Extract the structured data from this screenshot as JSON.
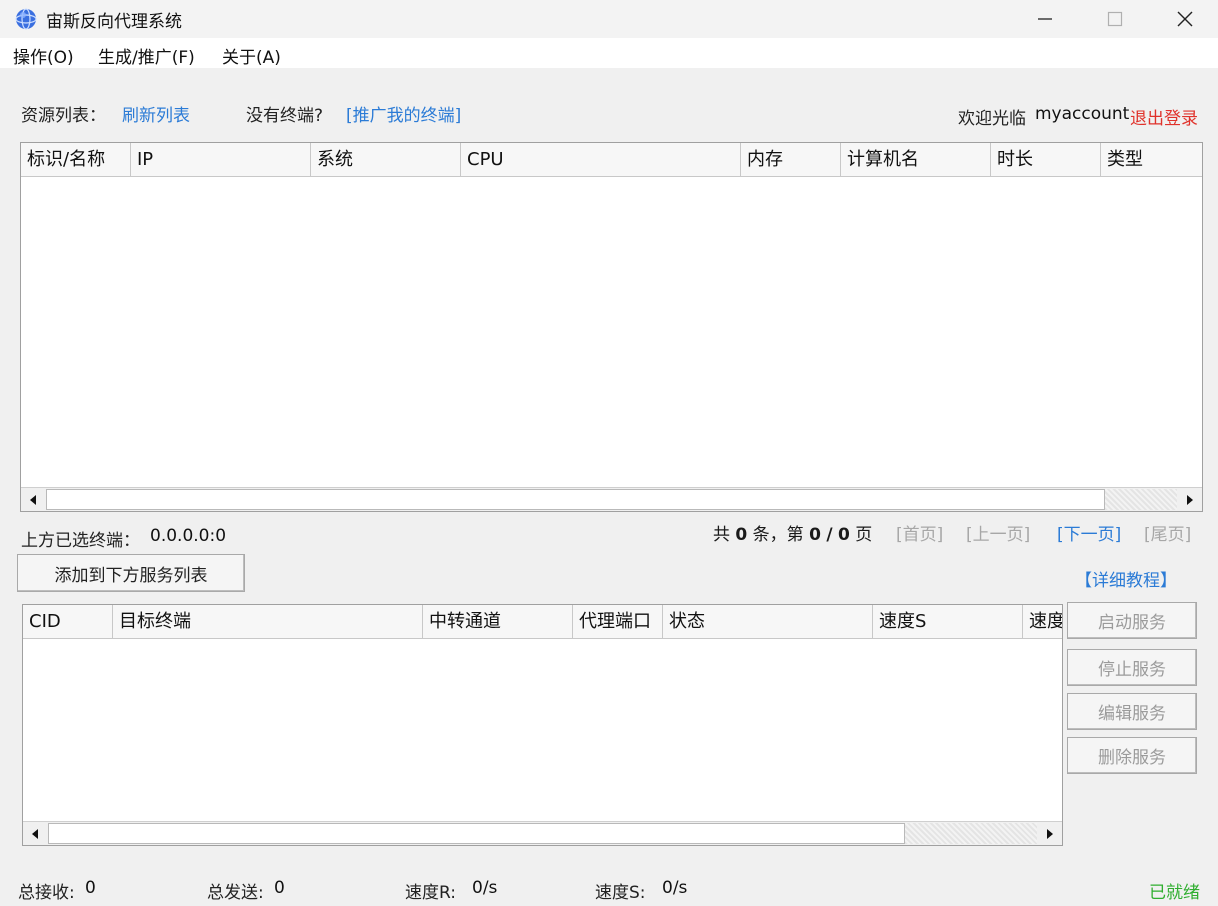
{
  "window": {
    "title": "宙斯反向代理系统",
    "controls": {
      "minimize": "—",
      "maximize": "☐",
      "close": "✕"
    }
  },
  "menu": [
    {
      "label": "操作(O)"
    },
    {
      "label": "生成/推广(F)"
    },
    {
      "label": "关于(A)"
    }
  ],
  "top_bar": {
    "resource_label": "资源列表：",
    "refresh_link": "刷新列表",
    "no_terminal_label": "没有终端?",
    "promote_link": "[推广我的终端]",
    "welcome_label": "欢迎光临",
    "username": "myaccount",
    "logout_link": "退出登录"
  },
  "terminal_table": {
    "columns": [
      "标识/名称",
      "IP",
      "系统",
      "CPU",
      "内存",
      "计算机名",
      "时长",
      "类型"
    ],
    "rows": []
  },
  "selection": {
    "label": "上方已选终端：",
    "value": "0.0.0.0:0"
  },
  "pagination": {
    "total_prefix": "共",
    "total_count": "0",
    "total_suffix": "条，第",
    "current_page": "0",
    "separator": "/",
    "total_pages": "0",
    "page_suffix": "页",
    "first": "[首页]",
    "prev": "[上一页]",
    "next": "[下一页]",
    "last": "[尾页]"
  },
  "add_button": "添加到下方服务列表",
  "tutorial_link": "【详细教程】",
  "service_table": {
    "columns": [
      "CID",
      "目标终端",
      "中转通道",
      "代理端口",
      "状态",
      "速度S",
      "速度"
    ],
    "rows": []
  },
  "service_buttons": {
    "start": "启动服务",
    "stop": "停止服务",
    "edit": "编辑服务",
    "delete": "删除服务"
  },
  "status_bar": {
    "recv_label": "总接收:",
    "recv_value": "0",
    "send_label": "总发送:",
    "send_value": "0",
    "speed_r_label": "速度R:",
    "speed_r_value": "0/s",
    "speed_s_label": "速度S:",
    "speed_s_value": "0/s",
    "ready": "已就绪"
  },
  "colors": {
    "link": "#2b7bd6",
    "logout": "#e0322b",
    "ready": "#2fae2f",
    "disabled": "#a7a7a7"
  }
}
